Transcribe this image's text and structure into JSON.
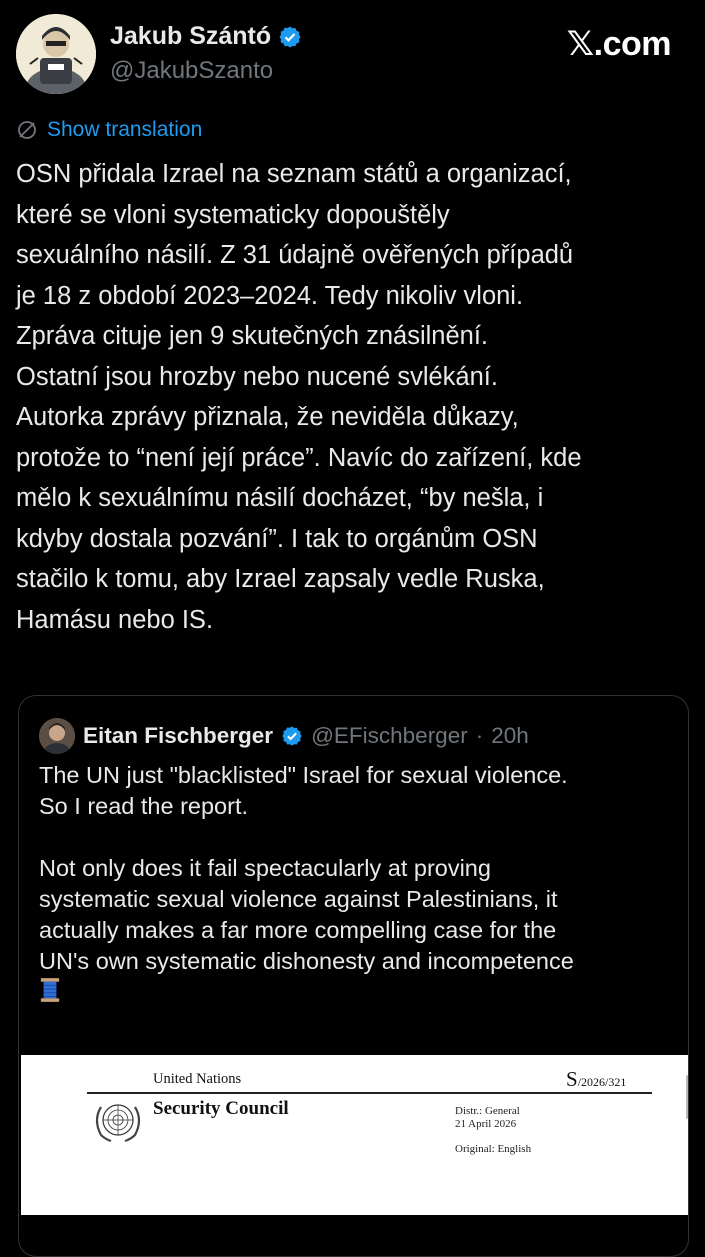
{
  "author": {
    "display_name": "Jakub Szántó",
    "handle": "@JakubSzanto",
    "avatar_icon": "cartoon-reporter-avatar",
    "verified_icon": "verified-badge-icon"
  },
  "brand": {
    "logo_text": "𝕏.com"
  },
  "translation": {
    "label": "Show translation",
    "icon": "translate-icon"
  },
  "tweet": {
    "text": "OSN přidala Izrael na seznam států a organizací,\nkteré se vloni systematicky dopouštěly\nsexuálního násilí. Z 31 údajně ověřených případů\nje 18 z období 2023–2024. Tedy nikoliv vloni.\nZpráva cituje jen 9 skutečných znásilnění.\nOstatní jsou hrozby nebo nucené svlékání.\nAutorka zprávy přiznala, že neviděla důkazy,\nprotože to “není její práce”. Navíc do zařízení, kde\nmělo k sexuálnímu násilí docházet, “by nešla, i\nkdyby dostala pozvání”. I tak to orgánům OSN\nstačilo k tomu, aby Izrael zapsaly vedle Ruska,\nHamásu nebo IS."
  },
  "quoted_tweet": {
    "display_name": "Eitan Fischberger",
    "handle": "@EFischberger",
    "separator": "·",
    "time": "20h",
    "text": "The UN just \"blacklisted\" Israel for sexual violence.\nSo I read the report.\n\nNot only does it fail spectacularly at proving\nsystematic sexual violence against Palestinians, it\nactually makes a far more compelling case for the\nUN's own systematic dishonesty and incompetence",
    "emoji_icon": "thread-spool-icon",
    "document": {
      "org": "United Nations",
      "symbol_letter": "S",
      "symbol_number": "/2026/321",
      "body": "Security Council",
      "distr": "Distr.: General",
      "date": "21 April 2026",
      "original": "Original: English"
    }
  },
  "colors": {
    "background": "#000000",
    "text": "#e7e9ea",
    "muted": "#71767b",
    "link": "#1d9bf0",
    "border": "#2f3336"
  }
}
